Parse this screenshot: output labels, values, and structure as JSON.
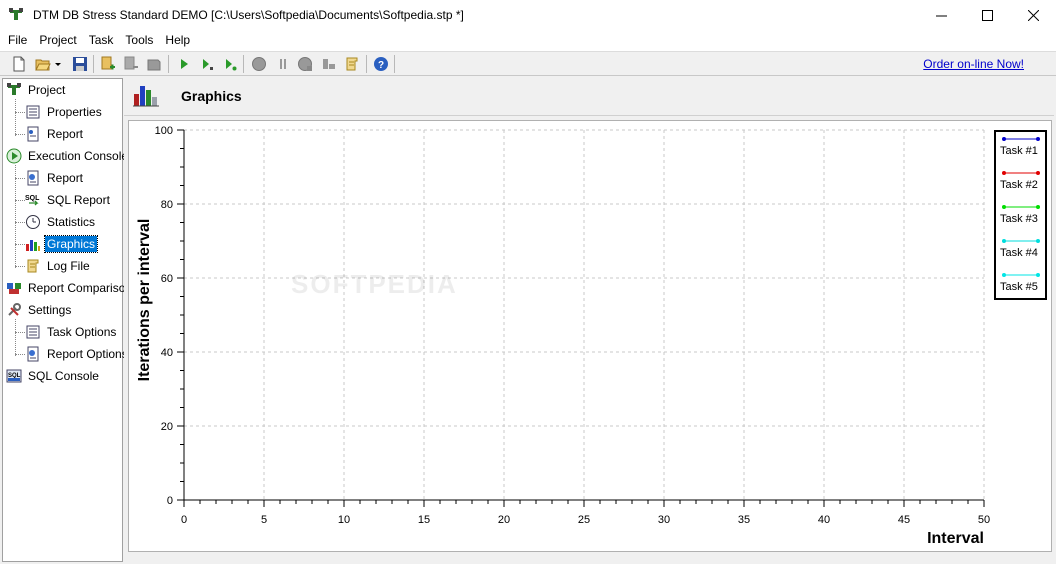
{
  "window": {
    "title": "DTM DB Stress Standard DEMO [C:\\Users\\Softpedia\\Documents\\Softpedia.stp *]"
  },
  "menu": [
    "File",
    "Project",
    "Task",
    "Tools",
    "Help"
  ],
  "toolbar": {
    "order_link": "Order on-line Now!",
    "icons": [
      "new-file-icon",
      "open-folder-icon",
      "dropdown-arrow-icon",
      "save-icon",
      "add-task-icon",
      "remove-task-icon",
      "task-props-icon",
      "run-icon",
      "run-step-icon",
      "run-next-icon",
      "stop-icon",
      "pause-icon",
      "stop-all-icon",
      "clear-icon",
      "script-icon",
      "help-icon"
    ]
  },
  "sidebar": {
    "items": [
      {
        "label": "Project",
        "icon": "project-icon",
        "level": 0
      },
      {
        "label": "Properties",
        "icon": "properties-icon",
        "level": 1
      },
      {
        "label": "Report",
        "icon": "report-icon",
        "level": 1
      },
      {
        "label": "Execution Console",
        "icon": "execution-console-icon",
        "level": 0
      },
      {
        "label": "Report",
        "icon": "report-icon",
        "level": 1
      },
      {
        "label": "SQL Report",
        "icon": "sql-report-icon",
        "level": 1
      },
      {
        "label": "Statistics",
        "icon": "statistics-clock-icon",
        "level": 1
      },
      {
        "label": "Graphics",
        "icon": "graphics-bar-icon",
        "level": 1,
        "selected": true
      },
      {
        "label": "Log File",
        "icon": "log-file-icon",
        "level": 1
      },
      {
        "label": "Report Comparison",
        "icon": "report-comparison-icon",
        "level": 0
      },
      {
        "label": "Settings",
        "icon": "settings-icon",
        "level": 0
      },
      {
        "label": "Task Options",
        "icon": "task-options-icon",
        "level": 1
      },
      {
        "label": "Report Options",
        "icon": "report-options-icon",
        "level": 1
      },
      {
        "label": "SQL Console",
        "icon": "sql-console-icon",
        "level": 0
      }
    ]
  },
  "panel": {
    "title": "Graphics"
  },
  "watermark": "SOFTPEDIA",
  "chart_data": {
    "type": "line",
    "xlabel": "Interval",
    "ylabel": "Iterations per interval",
    "xlim": [
      0,
      50
    ],
    "ylim": [
      0,
      100
    ],
    "x_ticks": [
      0,
      5,
      10,
      15,
      20,
      25,
      30,
      35,
      40,
      45,
      50
    ],
    "y_ticks": [
      0,
      20,
      40,
      60,
      80,
      100
    ],
    "grid": true,
    "legend_position": "top-right",
    "series": [
      {
        "name": "Task #1",
        "color": "#0000cc",
        "values": []
      },
      {
        "name": "Task #2",
        "color": "#e00000",
        "values": []
      },
      {
        "name": "Task #3",
        "color": "#00dd00",
        "values": []
      },
      {
        "name": "Task #4",
        "color": "#00dddd",
        "values": []
      },
      {
        "name": "Task #5",
        "color": "#00e5e5",
        "values": []
      }
    ]
  }
}
